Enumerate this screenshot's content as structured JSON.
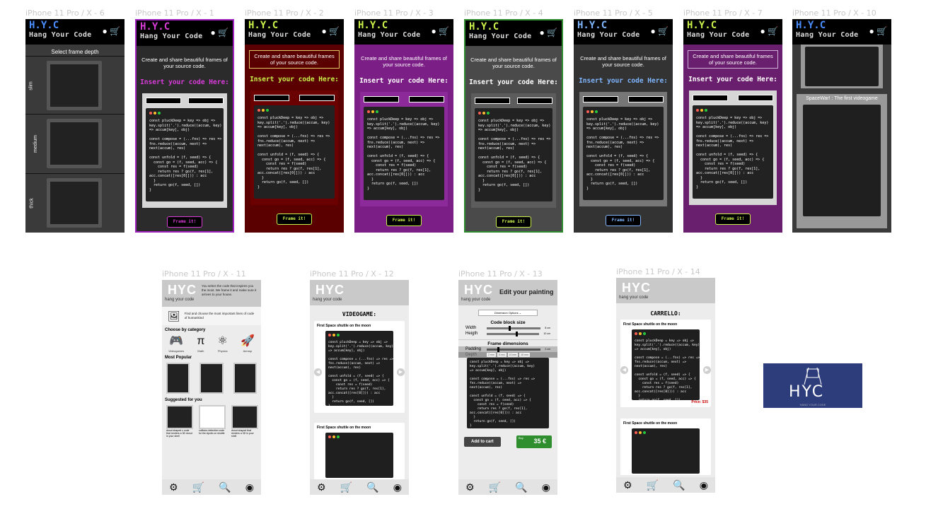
{
  "frames": {
    "labels": {
      "x6": "iPhone 11 Pro / X - 6",
      "x1": "iPhone 11 Pro / X - 1",
      "x2": "iPhone 11 Pro / X - 2",
      "x3": "iPhone 11 Pro / X - 3",
      "x4": "iPhone 11 Pro / X - 4",
      "x5": "iPhone 11 Pro / X - 5",
      "x7": "iPhone 11 Pro / X - 7",
      "x10": "iPhone 11 Pro / X - 10",
      "x11": "iPhone 11 Pro / X - 11",
      "x12": "iPhone 11 Pro / X - 12",
      "x13": "iPhone 11 Pro / X - 13",
      "x14": "iPhone 11 Pro / X - 14"
    }
  },
  "brand": {
    "logo_line1": "H.Y.C",
    "logo_line2": "Hang Your Code",
    "short": "HYC",
    "tagline": "hang your code",
    "tile_sub": "HANG YOUR CODE"
  },
  "editor": {
    "subtitle": "Create and share beautiful frames of your source code.",
    "insert_label": "Insert your code Here:",
    "frame_button": "Frame it!",
    "code": "const pluckDeep = key => obj =>\nkey.split('.').reduce((accum, key)\n=> accum[key], obj)\n\nconst compose = (...fns) => res =>\nfns.reduce((accum, next) =>\nnext(accum), res)\n\nconst unfold = (f, seed) => {\n  const go = (f, seed, acc) => {\n    const res = f(seed)\n    return res ? go(f, res[1],\nacc.concat([res[0]])) : acc\n  }\n  return go(f, seed, [])\n}"
  },
  "depth": {
    "title": "Select frame depth",
    "options": [
      "slim",
      "medium",
      "thick"
    ]
  },
  "product_x10": {
    "title": "SpaceWar! : The first videogame"
  },
  "home": {
    "intro": "You select the code that inspires you the most. We frame it and make sure it arrives to your house.",
    "find": "Find and choose the most important lines of code of humankind",
    "choose_by_category": "Choose by category",
    "categories": [
      "Videogames",
      "Math",
      "Physics",
      "Aerosp"
    ],
    "most_popular": "Most Popular",
    "suggested": "Suggested for you",
    "suggested_items": [
      "donut shaped c code that renders a 3D donut in your shell",
      "collision detection code for the Apollo on shuttle",
      "donut shaped that renders a 3D in your shell"
    ]
  },
  "videogame": {
    "heading": "VIDEOGAME:",
    "item1": "First Space shuttle on the moon",
    "item2": "First Space shuttle on the moon"
  },
  "edit": {
    "title": "Edit your painting",
    "dropdown": "Dimension Options",
    "code_block_size": "Code block size",
    "width": "Width",
    "heigth": "Heigth",
    "width_val": "8 cm",
    "heigth_val": "10 cm",
    "frame_dimensions": "Frame dimensions",
    "padding": "Padding",
    "depth": "Depth",
    "padding_val": "2 cm",
    "depth_opts": [
      "2 mm",
      "5 mm",
      "10 mm",
      "15 mm"
    ],
    "add_to_cart": "Add to cart",
    "buy": "Buy",
    "price": "35 €"
  },
  "cart": {
    "heading": "CARRELLO:",
    "item1": "First Space shuttle on the moon",
    "price": "Price: $35",
    "item2": "First Space shuttle on the moon"
  },
  "nav": {
    "icons": [
      "gear-icon",
      "cart-icon",
      "search-icon",
      "profile-icon"
    ]
  },
  "colors": {
    "x1_bg": "#2b2b2b",
    "x1_border": "#a020c0",
    "x1_accent": "#d83bd8",
    "x2_bg": "#5a0000",
    "x2_accent": "#c9f04a",
    "x3_bg": "#7b1e86",
    "x3_accent": "#ffffff",
    "x4_bg": "#4a4a4a",
    "x4_border": "#2e8b2e",
    "x4_accent": "#ffffff",
    "x5_bg": "#333333",
    "x5_accent": "#7fb6ff",
    "x7_bg": "#6a1f6e",
    "x7_accent": "#ffffff",
    "buy_green": "#2f8f2f"
  }
}
